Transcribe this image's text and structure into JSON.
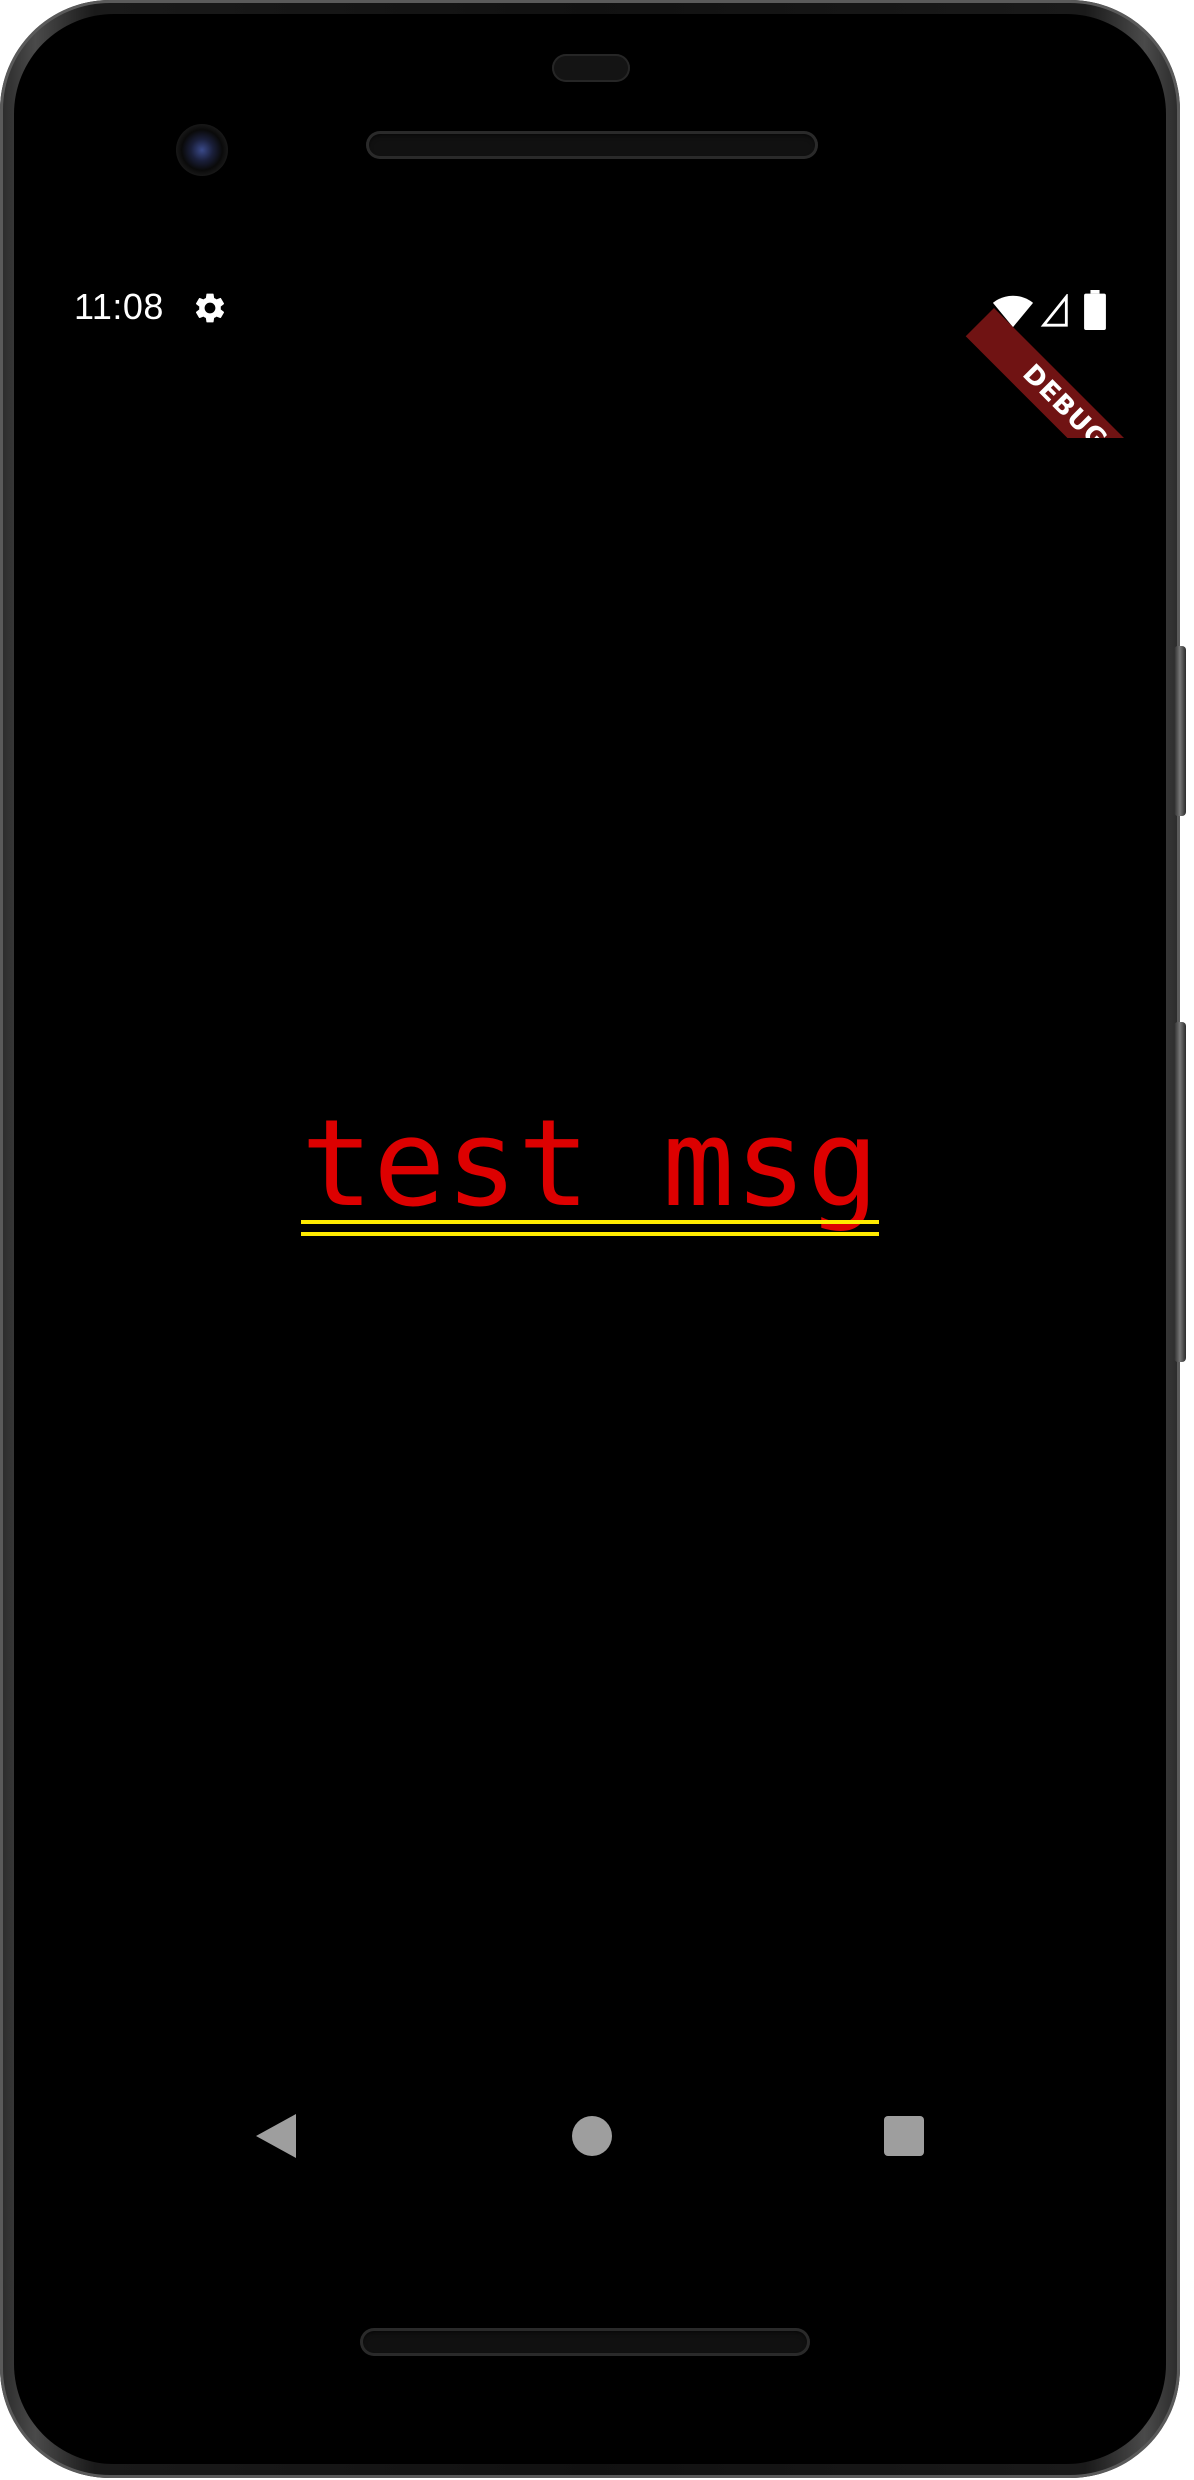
{
  "status_bar": {
    "time": "11:08",
    "icons": [
      "gear-icon",
      "wifi-icon",
      "signal-icon",
      "battery-icon"
    ]
  },
  "debug_banner": {
    "label": "DEBUG",
    "color": "#801616"
  },
  "main": {
    "message": "test msg",
    "message_color": "#dd0000",
    "underline_color": "#ffea00",
    "background": "#000000"
  },
  "nav_bar": {
    "icons": [
      "back-icon",
      "home-icon",
      "recents-icon"
    ],
    "color": "#9e9e9e"
  }
}
